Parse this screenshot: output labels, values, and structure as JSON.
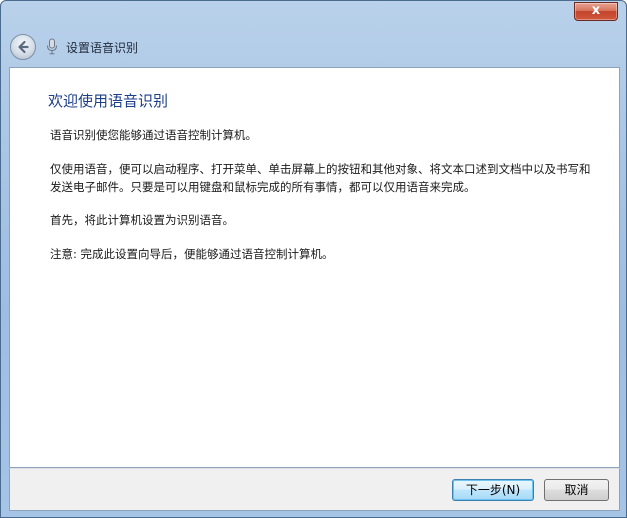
{
  "window": {
    "title": "设置语音识别",
    "close_label": "x"
  },
  "icons": {
    "back": "back-arrow-icon",
    "title": "microphone-icon"
  },
  "content": {
    "heading": "欢迎使用语音识别",
    "paragraphs": [
      "语音识别使您能够通过语音控制计算机。",
      "仅使用语音，便可以启动程序、打开菜单、单击屏幕上的按钮和其他对象、将文本口述到文档中以及书写和发送电子邮件。只要是可以用键盘和鼠标完成的所有事情，都可以仅用语音来完成。",
      "首先，将此计算机设置为识别语音。",
      "注意: 完成此设置向导后，便能够通过语音控制计算机。"
    ]
  },
  "footer": {
    "next_label": "下一步(N)",
    "cancel_label": "取消"
  },
  "colors": {
    "heading": "#1e3f8a",
    "frame": "#a9c5e6",
    "close_button": "#c2432a"
  }
}
